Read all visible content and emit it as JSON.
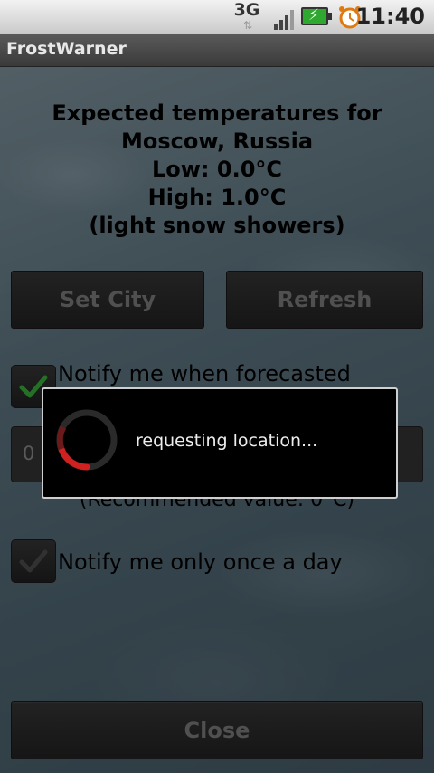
{
  "status_bar": {
    "network": "3G",
    "network_arrows": "⇅",
    "time": "11:40",
    "icons": [
      "signal-icon",
      "battery-charging-icon",
      "alarm-clock-icon"
    ]
  },
  "app": {
    "title": "FrostWarner"
  },
  "forecast": {
    "line1": "Expected temperatures for",
    "line2": "Moscow, Russia",
    "line3": "Low: 0.0°C",
    "line4": "High: 1.0°C",
    "line5": "(light snow showers)"
  },
  "buttons": {
    "set_city": "Set City",
    "refresh": "Refresh",
    "close": "Close"
  },
  "notify_forecast": {
    "label": "Notify me when forecasted",
    "checked": true
  },
  "threshold": {
    "value": "0",
    "recommended": "(Recommended value: 0°C)"
  },
  "notify_once": {
    "label": "Notify me only once a day",
    "checked": true
  },
  "dialog": {
    "message": "requesting location..."
  },
  "colors": {
    "check_active": "#3fc23f",
    "check_disabled": "#555555",
    "spinner_accent": "#d02020"
  }
}
